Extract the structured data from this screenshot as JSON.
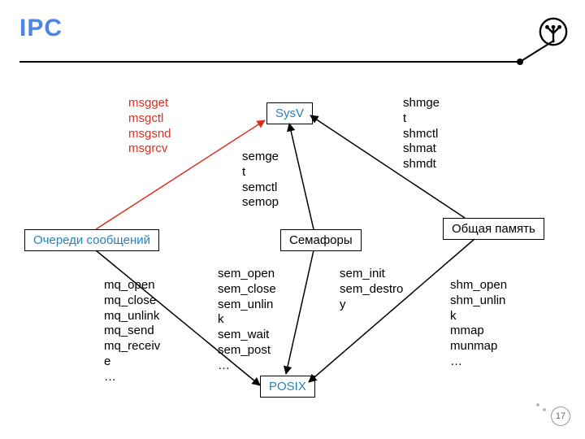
{
  "title": "IPC",
  "page_number": "17",
  "nodes": {
    "sysv": "SysV",
    "posix": "POSIX",
    "queues": "Очереди сообщений",
    "semaphores": "Семафоры",
    "shared_mem": "Общая память"
  },
  "labels": {
    "msg_sysv": "msgget\nmsgctl\nmsgsnd\nmsgrcv",
    "sem_sysv": "semge\nt\nsemctl\nsemop",
    "shm_sysv": "shmge\nt\nshmctl\nshmat\nshmdt",
    "mq_posix": "mq_open\nmq_close\nmq_unlink\nmq_send\nmq_receiv\ne\n…",
    "sem_posix_named": "sem_open\nsem_close\nsem_unlin\nk\nsem_wait\nsem_post\n…",
    "sem_posix_unnamed": "sem_init\nsem_destro\ny",
    "shm_posix": "shm_open\nshm_unlin\nk\nmmap\nmunmap\n…"
  },
  "chart_data": {
    "type": "diagram",
    "title": "IPC",
    "nodes": [
      {
        "id": "sysv",
        "label": "SysV"
      },
      {
        "id": "posix",
        "label": "POSIX"
      },
      {
        "id": "queues",
        "label": "Очереди сообщений"
      },
      {
        "id": "semaphores",
        "label": "Семафоры"
      },
      {
        "id": "shared_mem",
        "label": "Общая память"
      }
    ],
    "edges": [
      {
        "from": "queues",
        "to": "sysv",
        "highlight": true,
        "api": [
          "msgget",
          "msgctl",
          "msgsnd",
          "msgrcv"
        ]
      },
      {
        "from": "semaphores",
        "to": "sysv",
        "api": [
          "semget",
          "semctl",
          "semop"
        ]
      },
      {
        "from": "shared_mem",
        "to": "sysv",
        "api": [
          "shmget",
          "shmctl",
          "shmat",
          "shmdt"
        ]
      },
      {
        "from": "queues",
        "to": "posix",
        "api": [
          "mq_open",
          "mq_close",
          "mq_unlink",
          "mq_send",
          "mq_receive",
          "…"
        ]
      },
      {
        "from": "semaphores",
        "to": "posix",
        "api_named": [
          "sem_open",
          "sem_close",
          "sem_unlink",
          "sem_wait",
          "sem_post",
          "…"
        ],
        "api_unnamed": [
          "sem_init",
          "sem_destroy"
        ]
      },
      {
        "from": "shared_mem",
        "to": "posix",
        "api": [
          "shm_open",
          "shm_unlink",
          "mmap",
          "munmap",
          "…"
        ]
      }
    ]
  }
}
